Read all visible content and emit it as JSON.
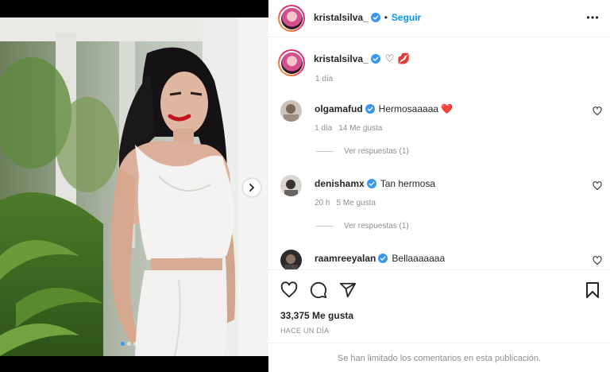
{
  "post": {
    "author": "kristalsilva_",
    "follow_label": "Seguir",
    "bullet": "•",
    "caption_text": "♡ 💋",
    "caption_time": "1 día",
    "likes_label": "33,375 Me gusta",
    "date_label": "HACE UN DÍA",
    "comments_limited": "Se han limitado los comentarios en esta publicación.",
    "carousel": {
      "slides": 3,
      "active": 1
    }
  },
  "comments": [
    {
      "user": "olgamafud",
      "text": "Hermosaaaaa ❤️",
      "time": "1 día",
      "likes": "14 Me gusta",
      "replies": "Ver respuestas (1)"
    },
    {
      "user": "denishamx",
      "text": "Tan hermosa",
      "time": "20 h",
      "likes": "5 Me gusta",
      "replies": "Ver respuestas (1)"
    },
    {
      "user": "raamreeyalan",
      "text": "Bellaaaaaaa"
    }
  ],
  "colors": {
    "accent": "#0095f6",
    "verified": "#3897f0",
    "muted": "#8e8e8e"
  },
  "icons": [
    "verified-badge-icon",
    "more-options-icon",
    "heart-icon",
    "comment-icon",
    "share-icon",
    "bookmark-icon",
    "chevron-right-icon"
  ]
}
